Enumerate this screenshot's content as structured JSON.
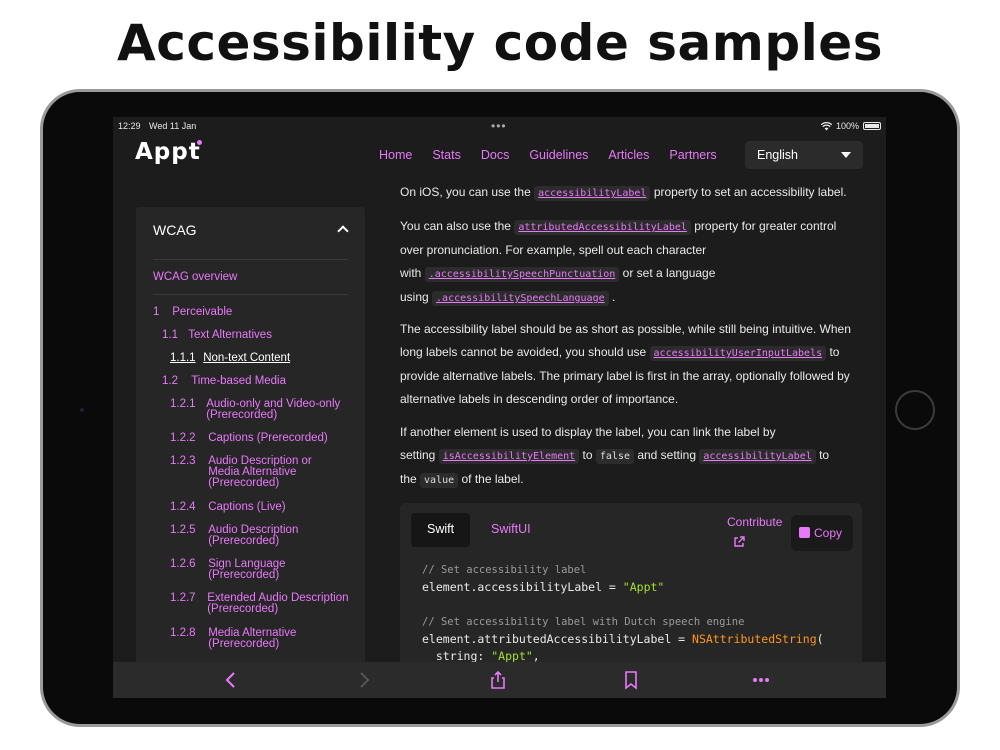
{
  "headline": "Accessibility code samples",
  "status": {
    "time": "12:29",
    "date": "Wed 11 Jan",
    "battery": "100%"
  },
  "logo": "Appt",
  "nav": {
    "links": [
      "Home",
      "Stats",
      "Docs",
      "Guidelines",
      "Articles",
      "Partners"
    ],
    "language": "English"
  },
  "sidebar": {
    "title": "WCAG",
    "overview": "WCAG overview",
    "items": [
      {
        "num": "1",
        "label": "Perceivable"
      },
      {
        "num": "1.1",
        "label": "Text Alternatives"
      },
      {
        "num": "1.1.1",
        "label": "Non-text Content"
      },
      {
        "num": "1.2",
        "label": "Time-based Media"
      },
      {
        "num": "1.2.1",
        "label": "Audio-only and Video-only (Prerecorded)"
      },
      {
        "num": "1.2.2",
        "label": "Captions (Prerecorded)"
      },
      {
        "num": "1.2.3",
        "label": "Audio Description or Media Alternative (Prerecorded)"
      },
      {
        "num": "1.2.4",
        "label": "Captions (Live)"
      },
      {
        "num": "1.2.5",
        "label": "Audio Description (Prerecorded)"
      },
      {
        "num": "1.2.6",
        "label": "Sign Language (Prerecorded)"
      },
      {
        "num": "1.2.7",
        "label": "Extended Audio Description (Prerecorded)"
      },
      {
        "num": "1.2.8",
        "label": "Media Alternative (Prerecorded)"
      }
    ]
  },
  "content": {
    "p1": {
      "a": "On iOS, you can use the",
      "code": "accessibilityLabel",
      "b": "property to set an accessibility label."
    },
    "p2": {
      "a": "You can also use the",
      "code1": "attributedAccessibilityLabel",
      "b": "property for greater control",
      "c": "over pronunciation. For example, spell out each character",
      "d": "with",
      "code2": ".accessibilitySpeechPunctuation",
      "e": "or set a language",
      "f": "using",
      "code3": ".accessibilitySpeechLanguage",
      "g": "."
    },
    "p3": {
      "a": "The accessibility label should be as short as possible, while still being intuitive. When",
      "b": "long labels cannot be avoided, you should use",
      "code": "accessibilityUserInputLabels",
      "c": "to",
      "d": "provide alternative labels. The primary label is first in the array, optionally followed by",
      "e": "alternative labels in descending order of importance."
    },
    "p4": {
      "a": "If another element is used to display the label, you can link the label by",
      "b": "setting",
      "code1": "isAccessibilityElement",
      "c": "to",
      "code2": "false",
      "d": "and setting",
      "code3": "accessibilityLabel",
      "e": "to",
      "f": "the",
      "code4": "value",
      "g": "of the label."
    }
  },
  "codecard": {
    "tabs": [
      "Swift",
      "SwiftUI"
    ],
    "contribute": "Contribute",
    "copy": "Copy",
    "lines": {
      "l1": "// Set accessibility label",
      "l2a": "element.accessibilityLabel = ",
      "l2b": "\"Appt\"",
      "l3": "// Set accessibility label with Dutch speech engine",
      "l4a": "element.attributedAccessibilityLabel = ",
      "l4b": "NSAttributedString",
      "l4c": "(",
      "l5a": "  string: ",
      "l5b": "\"Appt\"",
      "l5c": ","
    }
  },
  "colors": {
    "accent": "#e879f9",
    "background": "#1c1c1c",
    "panel": "#262626"
  },
  "icons": [
    "wifi-icon",
    "battery-icon",
    "chevron-up-icon",
    "chevron-down-icon",
    "external-link-icon",
    "copy-icon",
    "back-icon",
    "forward-icon",
    "share-icon",
    "bookmark-icon",
    "more-icon"
  ]
}
